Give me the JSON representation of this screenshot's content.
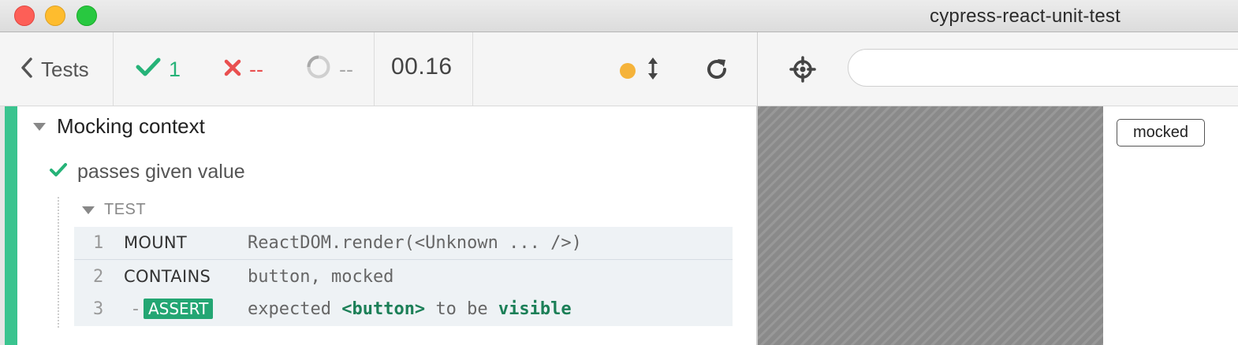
{
  "window": {
    "title": "cypress-react-unit-test"
  },
  "header": {
    "back_label": "Tests",
    "passed": "1",
    "failed": "--",
    "pending": "--",
    "duration": "00.16"
  },
  "aut_header": {
    "url_value": "",
    "url_placeholder": ""
  },
  "suite": {
    "title": "Mocking context",
    "test": {
      "title": "passes given value",
      "hook_label": "TEST",
      "commands": [
        {
          "number": "1",
          "name": "MOUNT",
          "message": "ReactDOM.render(<Unknown ... />)"
        },
        {
          "number": "2",
          "name": "CONTAINS",
          "message": "button, mocked"
        },
        {
          "number": "3",
          "prefix": "-",
          "name": "ASSERT",
          "message": {
            "part1": "expected",
            "part2": "<button>",
            "part3": "to be",
            "part4": "visible"
          }
        }
      ]
    }
  },
  "app": {
    "button_label": "mocked"
  },
  "colors": {
    "pass": "#26b378",
    "fail": "#e94f4f",
    "pending": "#a9a9a9",
    "running_dot": "#f5b33a",
    "assert_badge": "#23a673"
  },
  "icons": [
    "chevron-left-icon",
    "check-icon",
    "x-icon",
    "spinner-icon",
    "status-dot",
    "resize-arrows-icon",
    "restart-icon",
    "crosshair-icon",
    "caret-down-icon"
  ]
}
